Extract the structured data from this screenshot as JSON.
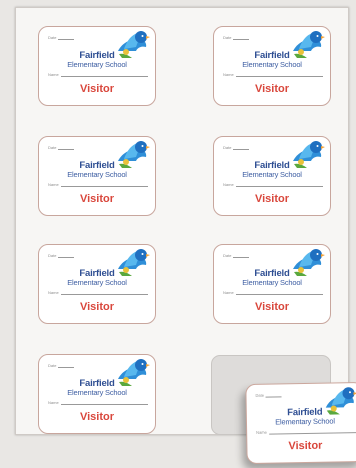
{
  "badge": {
    "date_label": "Date",
    "school_line1": "Fairfield",
    "school_line2": "Elementary School",
    "name_label": "Name",
    "role": "Visitor"
  },
  "colors": {
    "school_text": "#2f4f93",
    "visitor_text": "#d9473c",
    "badge_border": "#c8a69d"
  },
  "icons": [
    "bluebird-mascot-icon"
  ]
}
